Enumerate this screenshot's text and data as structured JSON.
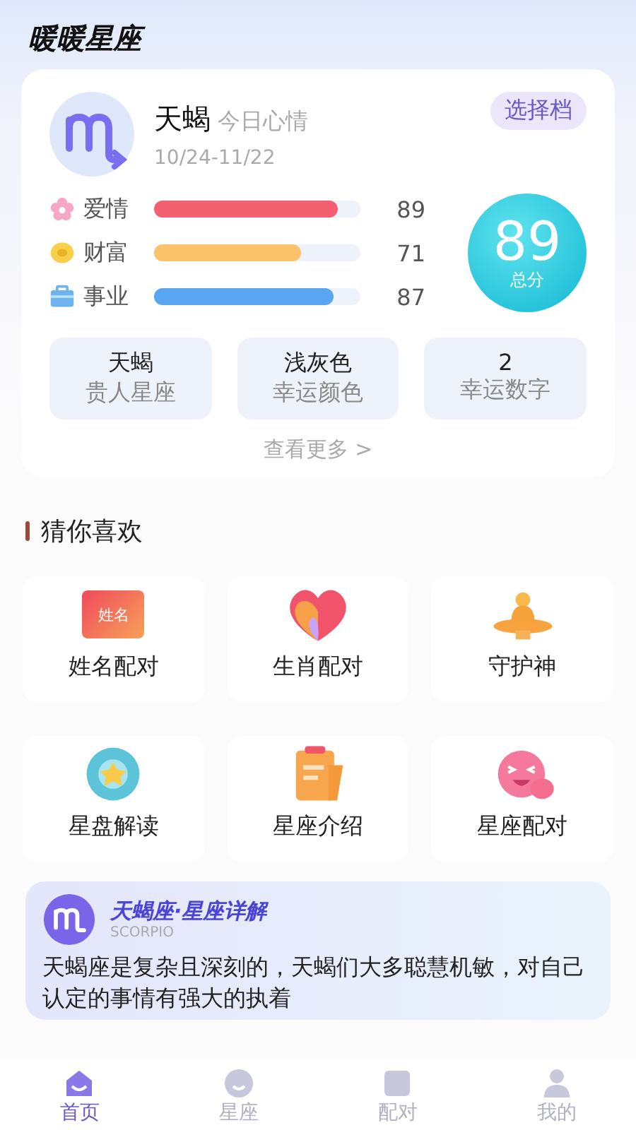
{
  "app_title": "暖暖星座",
  "sign": {
    "name": "天蝎",
    "subtitle": "今日心情",
    "dates": "10/24-11/22",
    "switch_button": "选择档"
  },
  "fortunes": [
    {
      "kind": "love",
      "label": "爱情",
      "level": 0.89,
      "reading": "89",
      "color": "#f4606f"
    },
    {
      "kind": "wealth",
      "label": "财富",
      "level": 0.71,
      "reading": "71",
      "color": "#fbc26a"
    },
    {
      "kind": "career",
      "label": "事业",
      "level": 0.87,
      "reading": "87",
      "color": "#5aa6f2"
    }
  ],
  "score": {
    "value": "89",
    "label": "总分"
  },
  "lucky": [
    {
      "value": "天蝎",
      "label": "贵人星座"
    },
    {
      "value": "浅灰色",
      "label": "幸运颜色"
    },
    {
      "value": "2",
      "label": "幸运数字"
    }
  ],
  "more_link": "查看更多 >",
  "section_title": "猜你喜欢",
  "features": [
    {
      "kind": "name",
      "label": "姓名配对",
      "icon_text": "姓名"
    },
    {
      "kind": "zodiac",
      "label": "生肖配对"
    },
    {
      "kind": "guardian",
      "label": "守护神"
    },
    {
      "kind": "chart",
      "label": "星盘解读"
    },
    {
      "kind": "intro",
      "label": "星座介绍"
    },
    {
      "kind": "match",
      "label": "星座配对"
    }
  ],
  "banner": {
    "title": "天蝎座·星座详解",
    "subtitle": "SCORPIO",
    "text": "天蝎座是复杂且深刻的，天蝎们大多聪慧机敏，对自己认定的事情有强大的执着"
  },
  "tabs": [
    {
      "kind": "home",
      "label": "首页",
      "selected": true
    },
    {
      "kind": "star",
      "label": "星座",
      "selected": false
    },
    {
      "kind": "pair",
      "label": "配对",
      "selected": false
    },
    {
      "kind": "me",
      "label": "我的",
      "selected": false
    }
  ]
}
